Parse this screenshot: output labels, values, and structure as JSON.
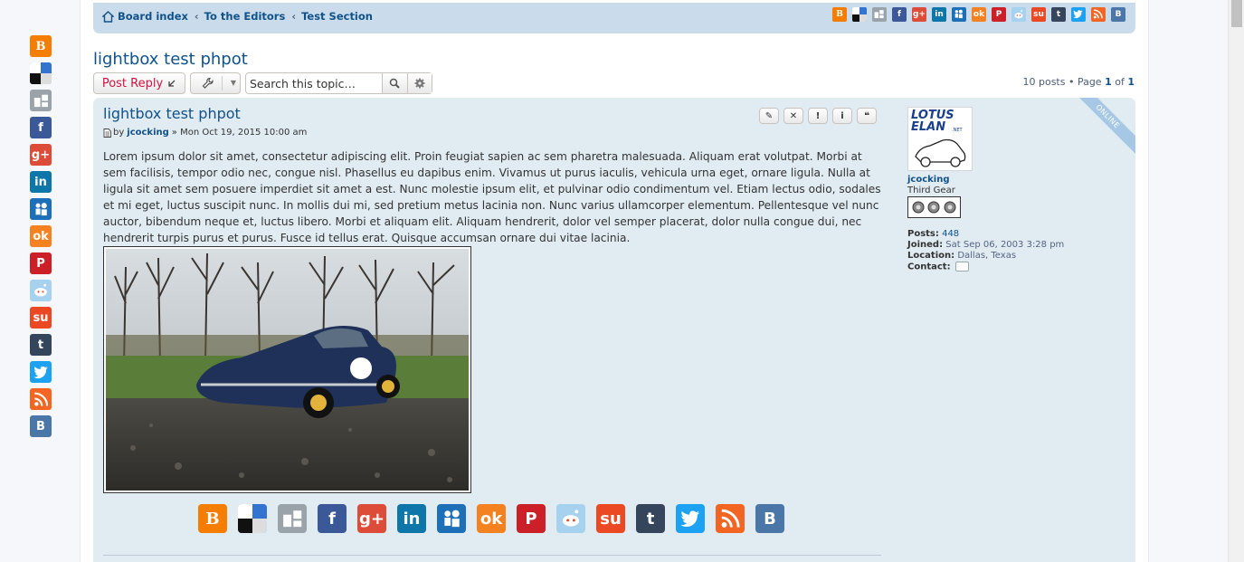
{
  "breadcrumb": {
    "items": [
      "Board index",
      "To the Editors",
      "Test Section"
    ]
  },
  "topic": {
    "title": "lightbox test phpot"
  },
  "actions": {
    "post_reply": "Post Reply",
    "search_placeholder": "Search this topic…",
    "pagination_prefix": "10 posts • Page",
    "page_current": "1",
    "page_of": "of",
    "page_total": "1"
  },
  "post": {
    "title": "lightbox test phpot",
    "by": "by",
    "author": "jcocking",
    "date": "» Mon Oct 19, 2015 10:00 am",
    "buttons": [
      "✎",
      "✕",
      "!",
      "i",
      "❝"
    ],
    "content": "Lorem ipsum dolor sit amet, consectetur adipiscing elit. Proin feugiat sapien ac sem pharetra malesuada. Aliquam erat volutpat. Morbi at sem facilisis, tempor odio nec, congue nisl. Phasellus eu dapibus enim. Vivamus ut purus iaculis, vehicula urna eget, ornare ligula. Nulla at ligula sit amet sem posuere imperdiet sit amet a est. Nunc molestie ipsum elit, et pulvinar odio condimentum vel. Etiam lectus odio, sodales et mi eget, luctus suscipit nunc. In mollis dui mi, sed pretium metus lacinia non. Nunc varius ullamcorper elementum. Pellentesque vel nunc auctor, bibendum neque et, luctus libero. Morbi et aliquam elit. Aliquam hendrerit, dolor vel semper placerat, dolor nulla congue dui, nec hendrerit turpis purus et purus. Fusce id tellus erat. Quisque accumsan ornare dui vitae lacinia."
  },
  "profile": {
    "status": "ONLINE",
    "avatar_text_1": "LOTUS",
    "avatar_text_2": "ELAN",
    "avatar_text_3": ".NET",
    "username": "jcocking",
    "rank": "Third Gear",
    "posts_label": "Posts:",
    "posts_value": "448",
    "joined_label": "Joined:",
    "joined_value": "Sat Sep 06, 2003 3:28 pm",
    "location_label": "Location:",
    "location_value": "Dallas, Texas",
    "contact_label": "Contact:"
  },
  "share_icons": [
    {
      "name": "blogger",
      "color": "#f57d00",
      "glyph": "B"
    },
    {
      "name": "delicious",
      "color": "#3399ff",
      "glyph": ""
    },
    {
      "name": "digg",
      "color": "#9aa3aa",
      "glyph": ""
    },
    {
      "name": "facebook",
      "color": "#3b5998",
      "glyph": "f"
    },
    {
      "name": "google-plus",
      "color": "#dd4b39",
      "glyph": "g+"
    },
    {
      "name": "linkedin",
      "color": "#0e76a8",
      "glyph": "in"
    },
    {
      "name": "myspace",
      "color": "#1d6fb8",
      "glyph": ""
    },
    {
      "name": "odnoklassniki",
      "color": "#f58220",
      "glyph": "ok"
    },
    {
      "name": "pinterest",
      "color": "#cb2027",
      "glyph": "P"
    },
    {
      "name": "reddit",
      "color": "#a7d2ef",
      "glyph": ""
    },
    {
      "name": "stumbleupon",
      "color": "#eb4924",
      "glyph": "su"
    },
    {
      "name": "tumblr",
      "color": "#35465c",
      "glyph": "t"
    },
    {
      "name": "twitter",
      "color": "#1da1f2",
      "glyph": ""
    },
    {
      "name": "rss",
      "color": "#f26522",
      "glyph": ""
    },
    {
      "name": "vk",
      "color": "#4a76a8",
      "glyph": "B"
    }
  ],
  "colors": {
    "link": "#105289",
    "navbar": "#cadceb",
    "post_bg": "#e1ebf2",
    "reply_red": "#d31141"
  }
}
